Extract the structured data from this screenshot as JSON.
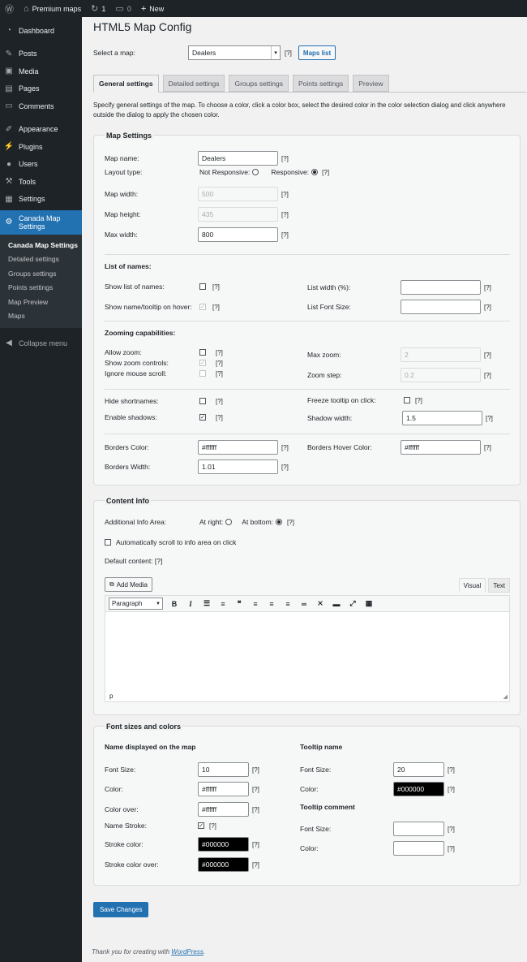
{
  "adminbar": {
    "site_name": "Premium maps",
    "updates_count": "1",
    "comments_count": "0",
    "new_label": "New"
  },
  "sidebar": {
    "items": [
      {
        "label": "Dashboard",
        "icon": "dashboard-icon"
      },
      {
        "label": "Posts",
        "icon": "pin-icon"
      },
      {
        "label": "Media",
        "icon": "media-icon"
      },
      {
        "label": "Pages",
        "icon": "page-icon"
      },
      {
        "label": "Comments",
        "icon": "comment-icon"
      },
      {
        "label": "Appearance",
        "icon": "brush-icon"
      },
      {
        "label": "Plugins",
        "icon": "plug-icon"
      },
      {
        "label": "Users",
        "icon": "user-icon"
      },
      {
        "label": "Tools",
        "icon": "wrench-icon"
      },
      {
        "label": "Settings",
        "icon": "settings-icon"
      }
    ],
    "active_line1": "Canada Map",
    "active_line2": "Settings",
    "submenu": [
      "Canada Map Settings",
      "Detailed settings",
      "Groups settings",
      "Points settings",
      "Map Preview",
      "Maps"
    ],
    "collapse": "Collapse menu"
  },
  "page": {
    "title": "HTML5 Map Config",
    "select_label": "Select a map:",
    "selected_map": "Dealers",
    "help": "[?]",
    "maps_list": "Maps list",
    "tabs": [
      "General settings",
      "Detailed settings",
      "Groups settings",
      "Points settings",
      "Preview"
    ],
    "description": "Specify general settings of the map. To choose a color, click a color box, select the desired color in the color selection dialog and click anywhere outside the dialog to apply the chosen color."
  },
  "map_settings": {
    "title": "Map Settings",
    "map_name_label": "Map name:",
    "map_name": "Dealers",
    "layout_label": "Layout type:",
    "not_responsive": "Not Responsive:",
    "responsive": "Responsive:",
    "map_width_label": "Map width:",
    "map_width": "500",
    "map_height_label": "Map height:",
    "map_height": "435",
    "max_width_label": "Max width:",
    "max_width": "800",
    "list_names_head": "List of names:",
    "show_list_label": "Show list of names:",
    "show_tooltip_label": "Show name/tooltip on hover:",
    "list_width_label": "List width (%):",
    "list_width": "",
    "list_font_label": "List Font Size:",
    "list_font": "",
    "zoom_head": "Zooming capabilities:",
    "allow_zoom_label": "Allow zoom:",
    "show_zoom_label": "Show zoom controls:",
    "ignore_scroll_label": "Ignore mouse scroll:",
    "max_zoom_label": "Max zoom:",
    "max_zoom": "2",
    "zoom_step_label": "Zoom step:",
    "zoom_step": "0.2",
    "hide_short_label": "Hide shortnames:",
    "enable_shadows_label": "Enable shadows:",
    "freeze_label": "Freeze tooltip on click:",
    "shadow_width_label": "Shadow width:",
    "shadow_width": "1.5",
    "borders_color_label": "Borders Color:",
    "borders_color": "#ffffff",
    "borders_hover_label": "Borders Hover Color:",
    "borders_hover": "#ffffff",
    "borders_width_label": "Borders Width:",
    "borders_width": "1.01"
  },
  "content_info": {
    "title": "Content Info",
    "area_label": "Additional Info Area:",
    "at_right": "At right:",
    "at_bottom": "At bottom:",
    "auto_scroll": "Automatically scroll to info area on click",
    "default_content": "Default content: [?]",
    "add_media": "Add Media",
    "visual": "Visual",
    "text": "Text",
    "format": "Paragraph",
    "status": "p"
  },
  "fonts": {
    "title": "Font sizes and colors",
    "name_head": "Name displayed on the map",
    "font_size_label": "Font Size:",
    "font_size": "10",
    "color_label": "Color:",
    "color": "#ffffff",
    "color_over_label": "Color over:",
    "color_over": "#ffffff",
    "name_stroke_label": "Name Stroke:",
    "stroke_color_label": "Stroke color:",
    "stroke_color": "#000000",
    "stroke_over_label": "Stroke color over:",
    "stroke_over": "#000000",
    "tooltip_name_head": "Tooltip name",
    "tt_font_size": "20",
    "tt_color": "#000000",
    "tooltip_comment_head": "Tooltip comment",
    "tc_font_size": "",
    "tc_color": ""
  },
  "save_label": "Save Changes",
  "footer_text": "Thank you for creating with ",
  "footer_link": "WordPress",
  "colors": {
    "accent": "#2271b1",
    "admin_dark": "#1d2327"
  }
}
